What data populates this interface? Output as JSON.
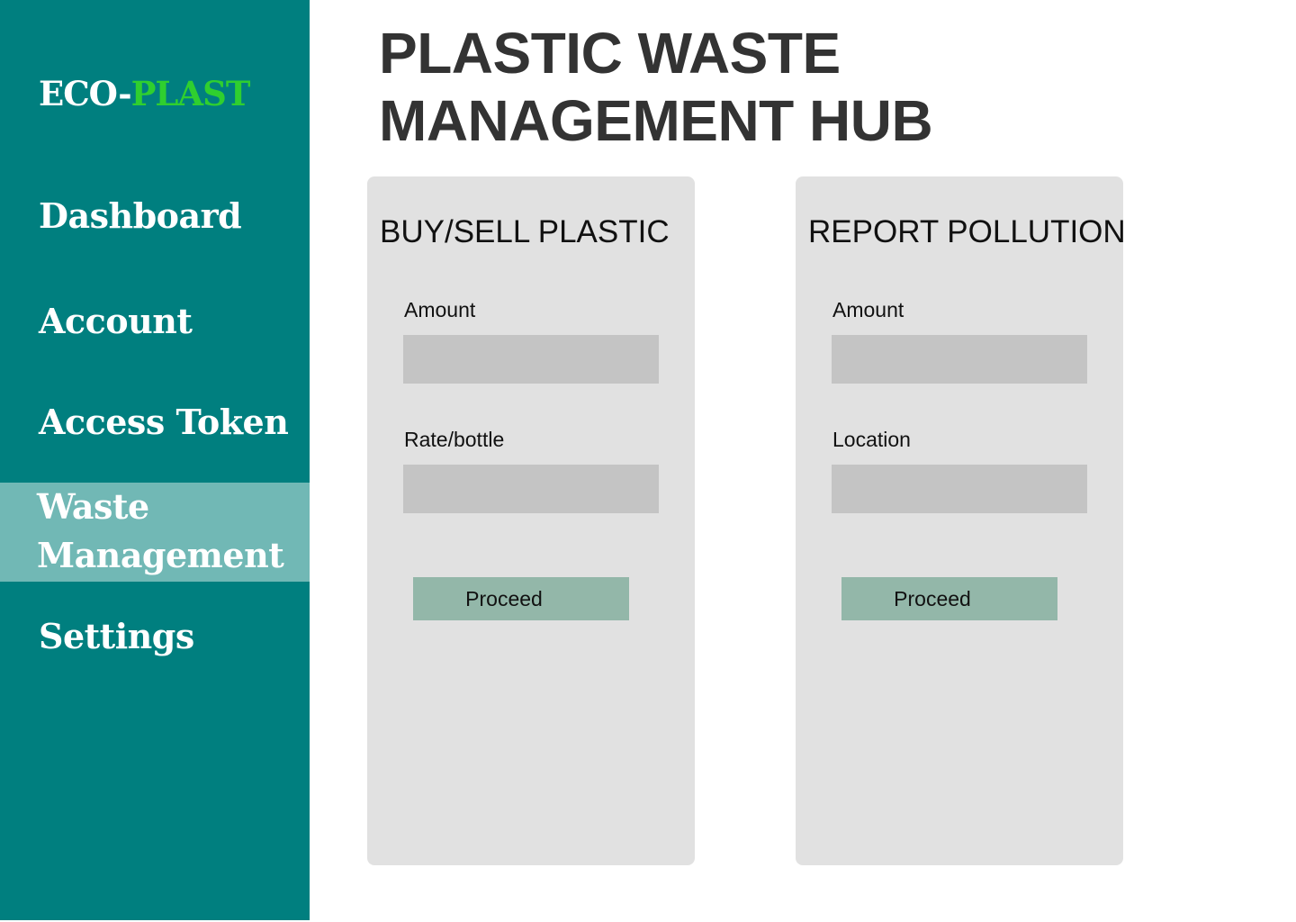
{
  "sidebar": {
    "logo": {
      "part1": "ECO-",
      "part2": "PLAST",
      "colors": {
        "part1": "#ffffff",
        "part2": "#2fcf2f"
      }
    },
    "background_color": "#007f7f",
    "active_color": "#71b8b5",
    "items": [
      {
        "label": "Dashboard",
        "active": false
      },
      {
        "label": "Account",
        "active": false
      },
      {
        "label": "Access Token",
        "active": false
      },
      {
        "label": "Waste Management",
        "active": true
      },
      {
        "label": "Settings",
        "active": false
      }
    ]
  },
  "main": {
    "title": "PLASTIC WASTE MANAGEMENT HUB",
    "cards": [
      {
        "title": "BUY/SELL PLASTIC",
        "fields": [
          {
            "label": "Amount",
            "value": "",
            "placeholder": ""
          },
          {
            "label": "Rate/bottle",
            "value": "",
            "placeholder": ""
          }
        ],
        "button_label": "Proceed"
      },
      {
        "title": "REPORT POLLUTION",
        "fields": [
          {
            "label": "Amount",
            "value": "",
            "placeholder": ""
          },
          {
            "label": "Location",
            "value": "",
            "placeholder": ""
          }
        ],
        "button_label": "Proceed"
      }
    ],
    "colors": {
      "card_background": "#e1e1e1",
      "input_background": "#c4c4c4",
      "button_background": "#93b7a9",
      "title_color": "#333333"
    }
  }
}
